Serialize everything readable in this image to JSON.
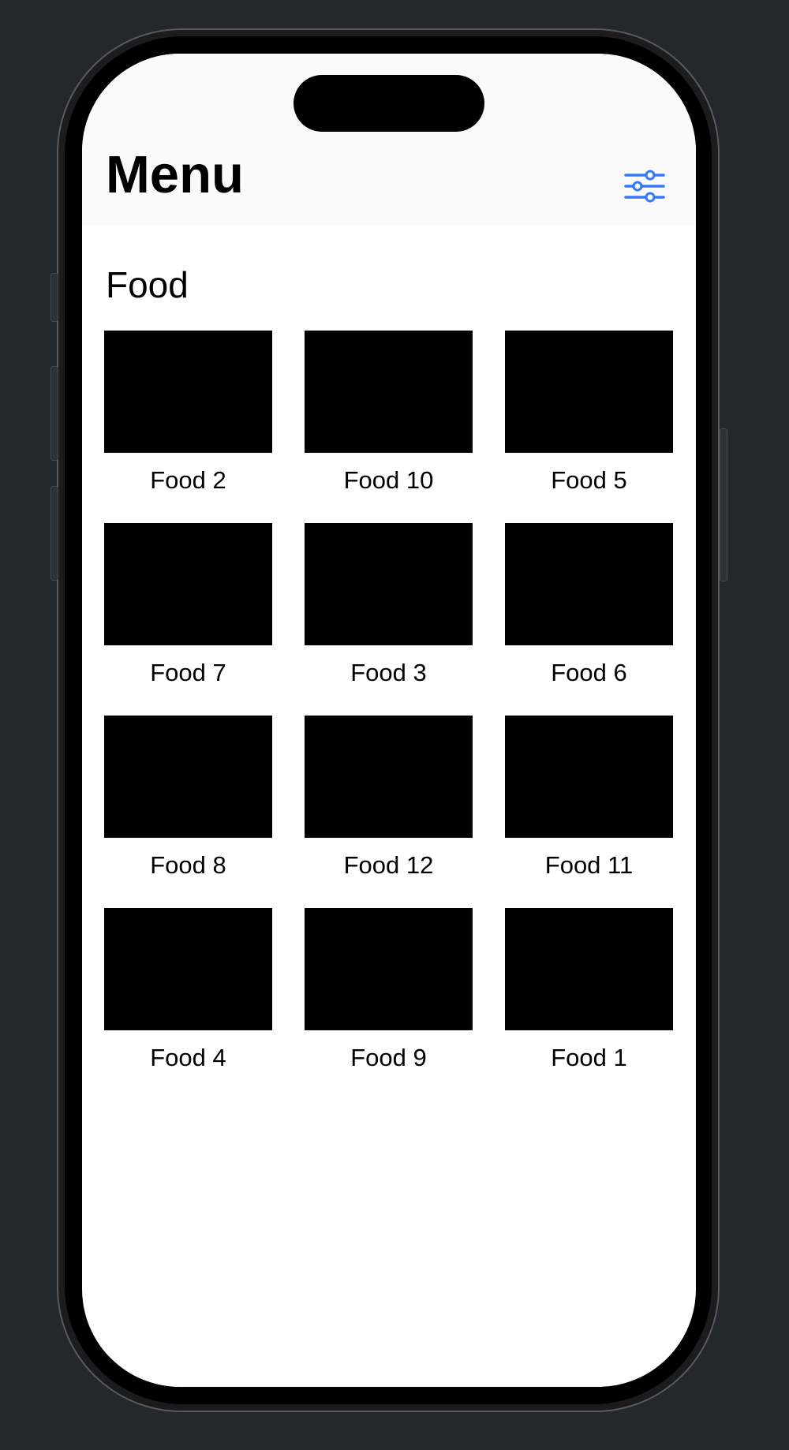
{
  "nav": {
    "title": "Menu",
    "filter_icon": "sliders-icon",
    "accent_color": "#3478f6"
  },
  "section": {
    "title": "Food"
  },
  "items": [
    {
      "label": "Food 2"
    },
    {
      "label": "Food 10"
    },
    {
      "label": "Food 5"
    },
    {
      "label": "Food 7"
    },
    {
      "label": "Food 3"
    },
    {
      "label": "Food 6"
    },
    {
      "label": "Food 8"
    },
    {
      "label": "Food 12"
    },
    {
      "label": "Food 11"
    },
    {
      "label": "Food 4"
    },
    {
      "label": "Food 9"
    },
    {
      "label": "Food 1"
    }
  ]
}
